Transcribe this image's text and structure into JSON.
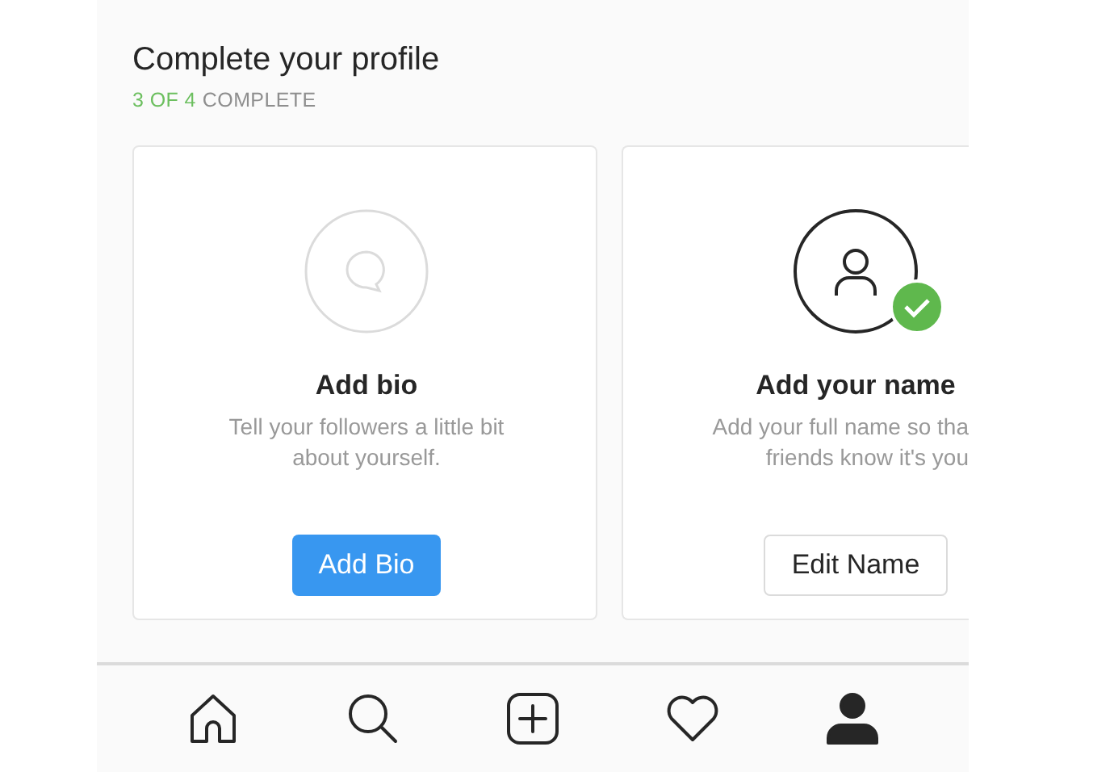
{
  "header": {
    "title": "Complete your profile",
    "progress": {
      "done": "3 OF 4",
      "rest": "COMPLETE"
    }
  },
  "cards": [
    {
      "kind": "bio",
      "completed": false,
      "title": "Add bio",
      "description_lines": [
        "Tell your followers a little bit",
        "about yourself."
      ],
      "button": {
        "label": "Add Bio"
      }
    },
    {
      "kind": "name",
      "completed": true,
      "title": "Add your name",
      "description_lines": [
        "Add your full name so tha",
        "friends know it's you"
      ],
      "button": {
        "label": "Edit Name"
      }
    }
  ],
  "nav": [
    {
      "kind": "home",
      "selected": false
    },
    {
      "kind": "search",
      "selected": false
    },
    {
      "kind": "add",
      "selected": false
    },
    {
      "kind": "heart",
      "selected": false
    },
    {
      "kind": "profile",
      "selected": true
    }
  ]
}
